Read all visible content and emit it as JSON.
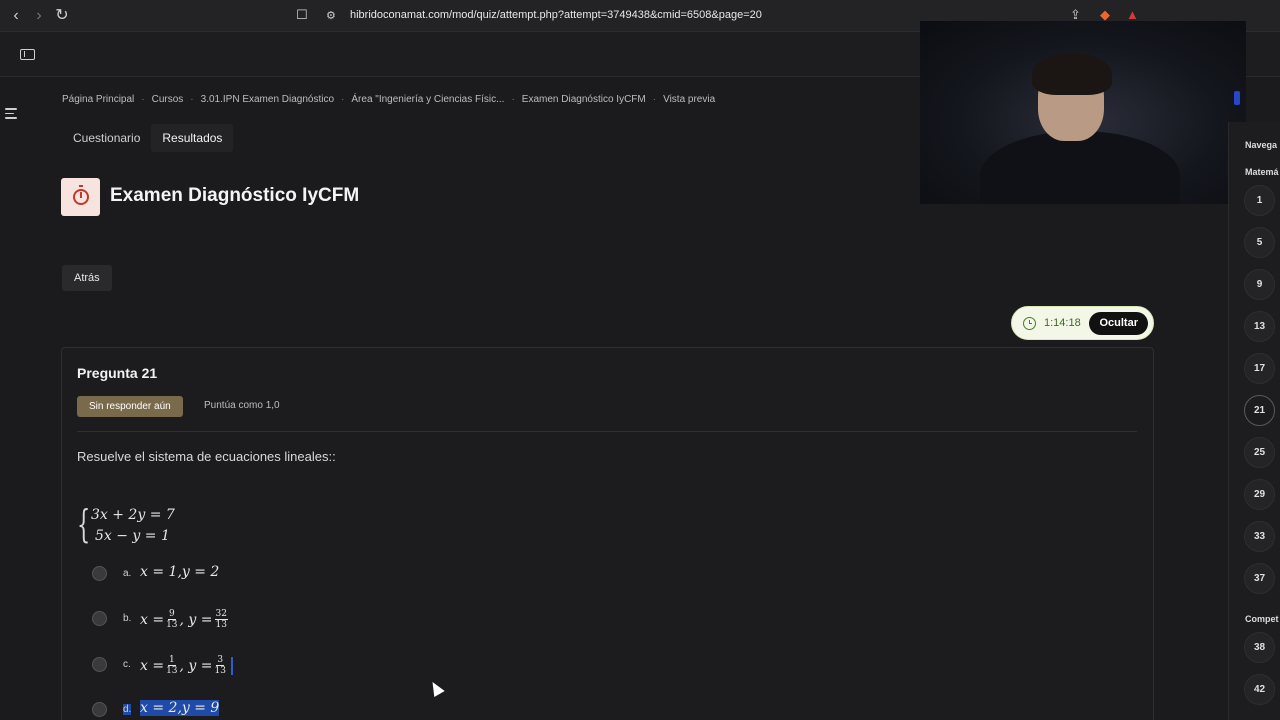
{
  "browser": {
    "url": "hibridoconamat.com/mod/quiz/attempt.php?attempt=3749438&cmid=6508&page=20",
    "back_icon": "chevron-left-icon",
    "forward_icon": "chevron-right-icon",
    "reload_icon": "reload-icon",
    "bookmark_icon": "bookmark-icon"
  },
  "breadcrumb": [
    "Página Principal",
    "Cursos",
    "3.01.IPN Examen Diagnóstico",
    "Área \"Ingeniería y Ciencias Físic...",
    "Examen Diagnóstico IyCFM",
    "Vista previa"
  ],
  "tabs": [
    {
      "label": "Cuestionario",
      "active": false
    },
    {
      "label": "Resultados",
      "active": true
    }
  ],
  "page": {
    "title": "Examen Diagnóstico IyCFM",
    "back_label": "Atrás"
  },
  "timer": {
    "time": "1:14:18",
    "hide_label": "Ocultar"
  },
  "question": {
    "title": "Pregunta 21",
    "state": "Sin responder aún",
    "grade": "Puntúa como 1,0",
    "text": "Resuelve el sistema de ecuaciones lineales::",
    "equation_1": "3x + 2y = 7",
    "equation_2": "5x − y = 1",
    "options": [
      {
        "letter": "a.",
        "x": "x = 1",
        "y": "y = 2"
      },
      {
        "letter": "b.",
        "x_num": "9",
        "x_den": "13",
        "y_num": "32",
        "y_den": "13"
      },
      {
        "letter": "c.",
        "x_num": "1",
        "x_den": "13",
        "y_num": "3",
        "y_den": "13"
      },
      {
        "letter": "d.",
        "x": "x = 2",
        "y": "y = 9"
      }
    ]
  },
  "qnav": {
    "heading": "Navega",
    "section_1": "Matemá",
    "section_2": "Compet",
    "buttons_1": [
      "1",
      "5",
      "9",
      "13",
      "17",
      "21",
      "25",
      "29",
      "33",
      "37"
    ],
    "buttons_2": [
      "38",
      "42"
    ],
    "current": "21"
  }
}
